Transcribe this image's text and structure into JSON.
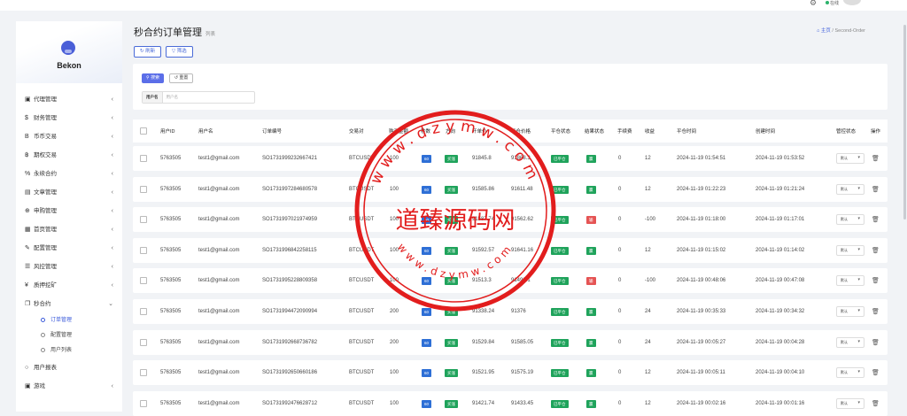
{
  "topbar": {
    "online": "在线"
  },
  "sidebar": {
    "brand": "Bekon",
    "items": [
      {
        "label": "代理管理",
        "icon": "id-card-icon",
        "glyph": "▣",
        "arrow": true
      },
      {
        "label": "财务管理",
        "icon": "dollar-icon",
        "glyph": "$",
        "arrow": true
      },
      {
        "label": "币币交易",
        "icon": "bitcoin-icon",
        "glyph": "B",
        "arrow": true
      },
      {
        "label": "期权交易",
        "icon": "bitcoin-small-icon",
        "glyph": "฿",
        "arrow": true
      },
      {
        "label": "永续合约",
        "icon": "link-icon",
        "glyph": "%",
        "arrow": true
      },
      {
        "label": "文章管理",
        "icon": "article-icon",
        "glyph": "▤",
        "arrow": true
      },
      {
        "label": "申购管理",
        "icon": "globe-icon",
        "glyph": "⊕",
        "arrow": true
      },
      {
        "label": "首页管理",
        "icon": "grid-icon",
        "glyph": "▦",
        "arrow": true
      },
      {
        "label": "配置管理",
        "icon": "wrench-icon",
        "glyph": "✎",
        "arrow": true
      },
      {
        "label": "风控管理",
        "icon": "list-icon",
        "glyph": "☰",
        "arrow": true
      },
      {
        "label": "质押挖矿",
        "icon": "yen-icon",
        "glyph": "¥",
        "arrow": true
      },
      {
        "label": "秒合约",
        "icon": "copy-icon",
        "glyph": "❐",
        "arrow": true,
        "expanded": true
      }
    ],
    "sub": [
      {
        "label": "订单管理",
        "active": true
      },
      {
        "label": "配置管理",
        "active": false
      },
      {
        "label": "用户列表",
        "active": false
      }
    ],
    "after": [
      {
        "label": "用户报表",
        "icon": "circle-icon",
        "glyph": "○",
        "arrow": false
      },
      {
        "label": "游戏",
        "icon": "game-icon",
        "glyph": "▣",
        "arrow": true
      }
    ]
  },
  "page": {
    "title": "秒合约订单管理",
    "subtitle": "列表",
    "breadcrumb_home": "主页",
    "breadcrumb_sep": "/",
    "breadcrumb_current": "Second-Order",
    "refresh": "刷新",
    "filter": "筛选"
  },
  "search": {
    "search_btn": "搜索",
    "reset_btn": "重置",
    "username_label": "用户名",
    "username_placeholder": "用户名"
  },
  "table": {
    "headers": {
      "uid": "用户ID",
      "username": "用户名",
      "order_no": "订单编号",
      "pair": "交易对",
      "amount": "购买金额",
      "period": "秒数",
      "direction": "方向",
      "open_price": "开单价",
      "close_price": "平仓价格",
      "close_status": "平仓状态",
      "result_status": "结果状态",
      "fee": "手续费",
      "profit": "收益",
      "close_time": "平仓时间",
      "create_time": "创建时间",
      "control_status": "管控状态",
      "action": "操作"
    },
    "rows": [
      {
        "uid": "5763505",
        "username": "test1@gmail.com",
        "order_no": "SO1731999232667421",
        "pair": "BTCUSDT",
        "amount": "100",
        "period": "60",
        "direction": "买涨",
        "open_price": "91845.8",
        "close_price": "91868.3",
        "close_status": "已平仓",
        "result": "赢",
        "fee": "0",
        "profit": "12",
        "close_time": "2024-11-19 01:54:51",
        "create_time": "2024-11-19 01:53:52",
        "control": "默认"
      },
      {
        "uid": "5763505",
        "username": "test1@gmail.com",
        "order_no": "SO1731997284680578",
        "pair": "BTCUSDT",
        "amount": "100",
        "period": "60",
        "direction": "买涨",
        "open_price": "91585.86",
        "close_price": "91611.48",
        "close_status": "已平仓",
        "result": "赢",
        "fee": "0",
        "profit": "12",
        "close_time": "2024-11-19 01:22:23",
        "create_time": "2024-11-19 01:21:24",
        "control": "默认"
      },
      {
        "uid": "5763505",
        "username": "test1@gmail.com",
        "order_no": "SO1731997021974959",
        "pair": "BTCUSDT",
        "amount": "100",
        "period": "60",
        "direction": "买涨",
        "open_price": "91587.74",
        "close_price": "91562.62",
        "close_status": "已平仓",
        "result": "输",
        "fee": "0",
        "profit": "-100",
        "close_time": "2024-11-19 01:18:00",
        "create_time": "2024-11-19 01:17:01",
        "control": "默认"
      },
      {
        "uid": "5763505",
        "username": "test1@gmail.com",
        "order_no": "SO1731996842258115",
        "pair": "BTCUSDT",
        "amount": "100",
        "period": "60",
        "direction": "买涨",
        "open_price": "91592.57",
        "close_price": "91641.16",
        "close_status": "已平仓",
        "result": "赢",
        "fee": "0",
        "profit": "12",
        "close_time": "2024-11-19 01:15:02",
        "create_time": "2024-11-19 01:14:02",
        "control": "默认"
      },
      {
        "uid": "5763505",
        "username": "test1@gmail.com",
        "order_no": "SO1731995228809358",
        "pair": "BTCUSDT",
        "amount": "100",
        "period": "60",
        "direction": "买涨",
        "open_price": "91513.3",
        "close_price": "91498.1",
        "close_status": "已平仓",
        "result": "输",
        "fee": "0",
        "profit": "-100",
        "close_time": "2024-11-19 00:48:06",
        "create_time": "2024-11-19 00:47:08",
        "control": "默认"
      },
      {
        "uid": "5763505",
        "username": "test1@gmail.com",
        "order_no": "SO1731994472090994",
        "pair": "BTCUSDT",
        "amount": "200",
        "period": "60",
        "direction": "买涨",
        "open_price": "91338.24",
        "close_price": "91376",
        "close_status": "已平仓",
        "result": "赢",
        "fee": "0",
        "profit": "24",
        "close_time": "2024-11-19 00:35:33",
        "create_time": "2024-11-19 00:34:32",
        "control": "默认"
      },
      {
        "uid": "5763505",
        "username": "test1@gmail.com",
        "order_no": "SO1731992668736782",
        "pair": "BTCUSDT",
        "amount": "200",
        "period": "60",
        "direction": "买涨",
        "open_price": "91529.84",
        "close_price": "91585.05",
        "close_status": "已平仓",
        "result": "赢",
        "fee": "0",
        "profit": "24",
        "close_time": "2024-11-19 00:05:27",
        "create_time": "2024-11-19 00:04:28",
        "control": "默认"
      },
      {
        "uid": "5763505",
        "username": "test1@gmail.com",
        "order_no": "SO1731992650660186",
        "pair": "BTCUSDT",
        "amount": "100",
        "period": "60",
        "direction": "买涨",
        "open_price": "91521.95",
        "close_price": "91575.19",
        "close_status": "已平仓",
        "result": "赢",
        "fee": "0",
        "profit": "12",
        "close_time": "2024-11-19 00:05:11",
        "create_time": "2024-11-19 00:04:10",
        "control": "默认"
      },
      {
        "uid": "5763505",
        "username": "test1@gmail.com",
        "order_no": "SO1731992476628712",
        "pair": "BTCUSDT",
        "amount": "100",
        "period": "60",
        "direction": "买涨",
        "open_price": "91421.74",
        "close_price": "91433.45",
        "close_status": "已平仓",
        "result": "赢",
        "fee": "0",
        "profit": "12",
        "close_time": "2024-11-19 00:02:16",
        "create_time": "2024-11-19 00:01:16",
        "control": "默认"
      }
    ]
  },
  "watermark": {
    "text": "道臻源码网",
    "ring_text": "www.dzymw.com"
  },
  "colors": {
    "primary": "#4a6bd8",
    "win": "#1fa35b",
    "lose": "#e55454",
    "period": "#2e6fd6",
    "stamp": "#e21d1d"
  }
}
